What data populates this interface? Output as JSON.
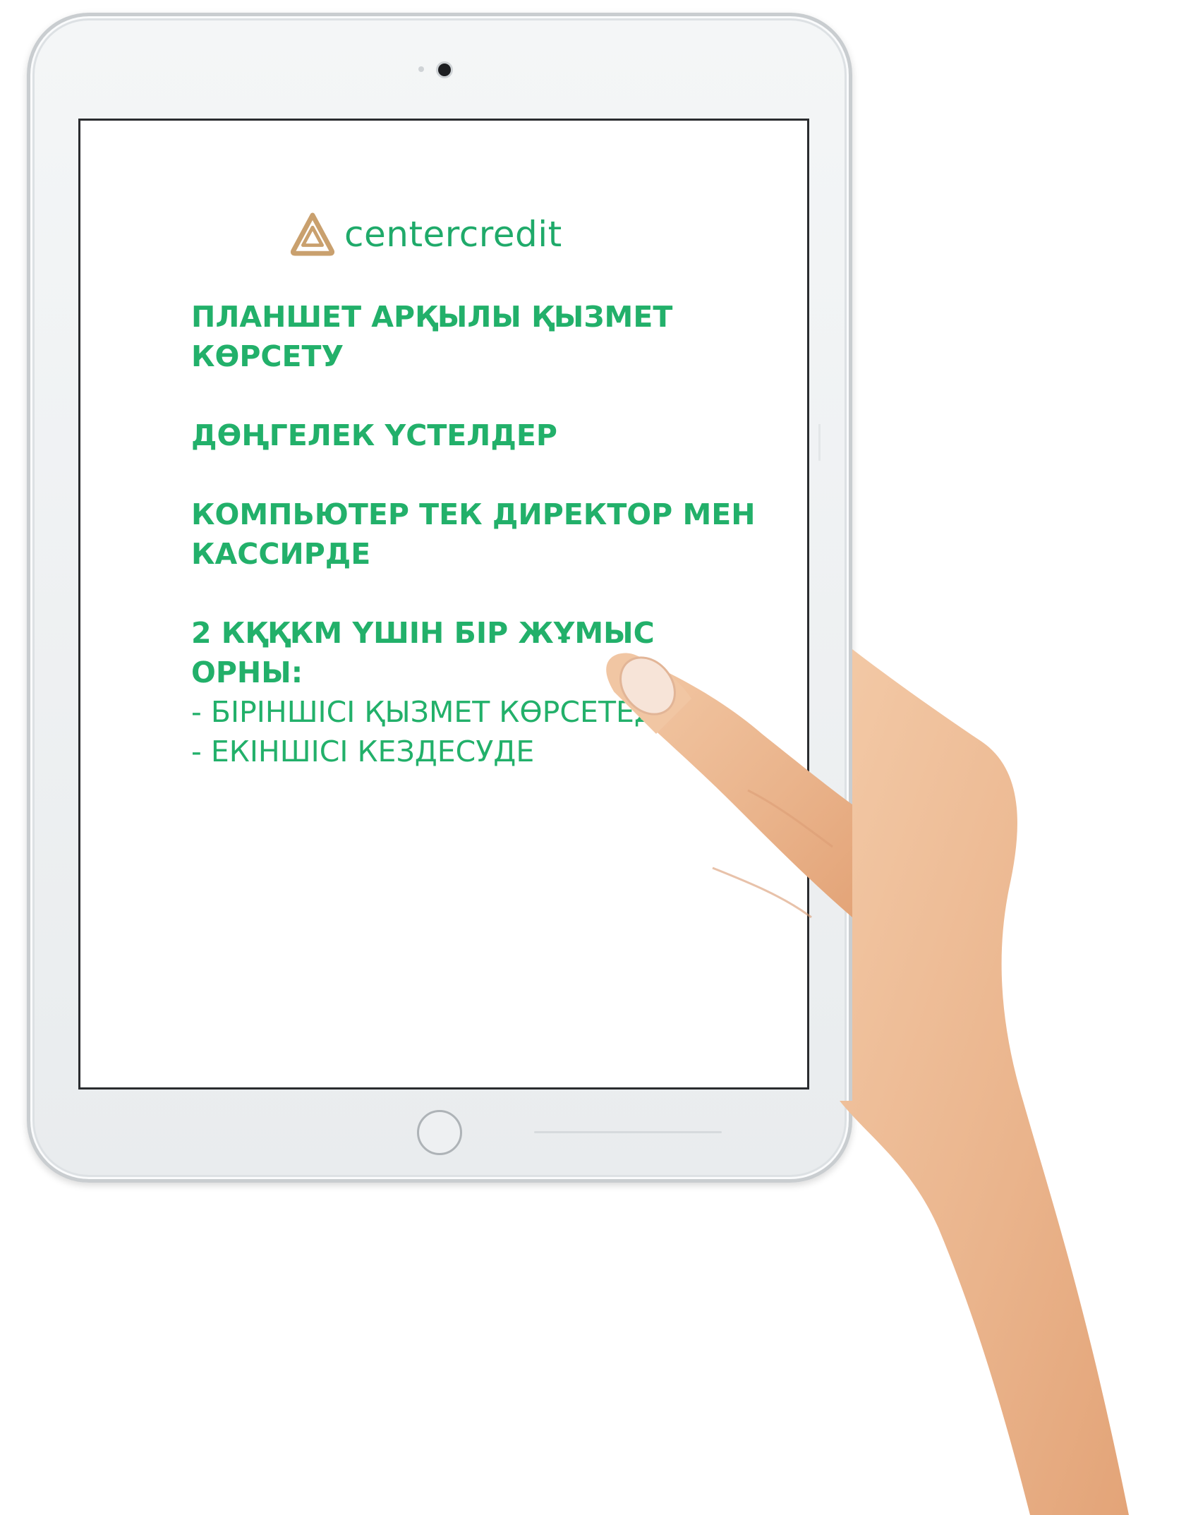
{
  "brand": {
    "name": "centercredit",
    "icon": "centercredit-logo-icon",
    "text_color": "#1faa6a",
    "icon_color": "#c9a06e"
  },
  "content": {
    "text_color": "#22b06a",
    "items": [
      {
        "text": "ПЛАНШЕТ АРҚЫЛЫ ҚЫЗМЕТ КӨРСЕТУ"
      },
      {
        "text": "ДӨҢГЕЛЕК ҮСТЕЛДЕР"
      },
      {
        "text": "КОМПЬЮТЕР ТЕК ДИРЕКТОР МЕН КАССИРДЕ"
      },
      {
        "text": "2 КҚҚКМ ҮШІН БІР ЖҰМЫС ОРНЫ:",
        "sub": [
          "- БІРІНШІСІ ҚЫЗМЕТ КӨРСЕТЕДІ",
          "- ЕКІНШІСІ КЕЗДЕСУДЕ"
        ]
      }
    ]
  }
}
